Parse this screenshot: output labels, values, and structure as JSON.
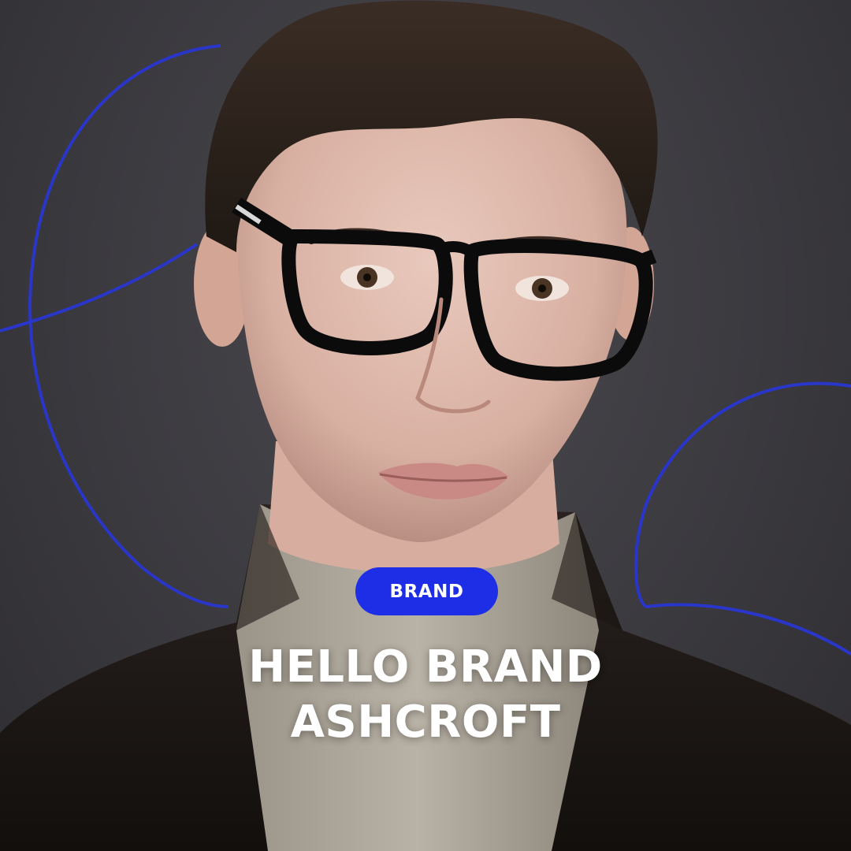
{
  "badge": {
    "label": "BRAND"
  },
  "headline": {
    "line1": "HELLO BRAND",
    "line2": "ASHCROFT"
  },
  "colors": {
    "background": "#3a393d",
    "accent_blue": "#1e2ee6",
    "text": "#ffffff"
  }
}
